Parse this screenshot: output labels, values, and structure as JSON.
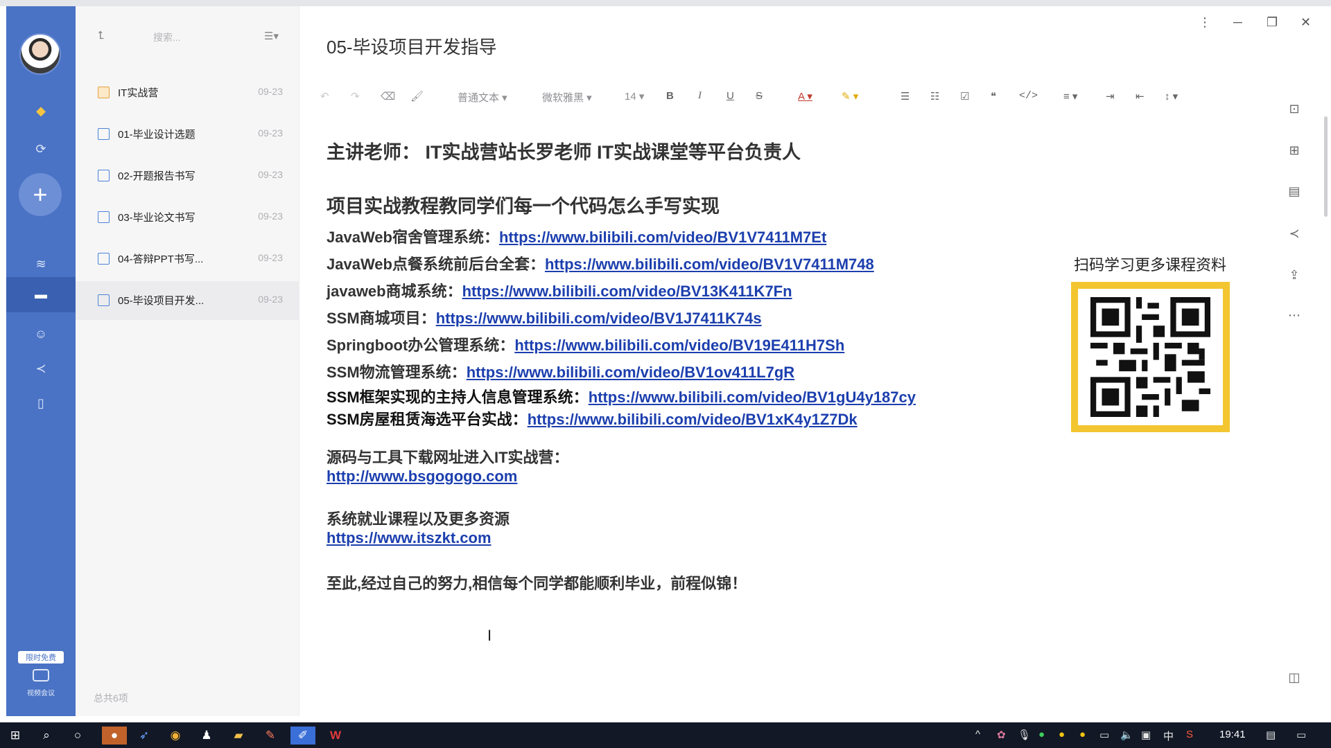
{
  "rail": {
    "icons": [
      "vip-icon",
      "sync-icon",
      "layers-icon",
      "folder-icon",
      "contacts-icon",
      "share-icon",
      "trash-icon"
    ],
    "trial_badge": "限时免费",
    "meeting_label": "视频会议"
  },
  "list": {
    "search_placeholder": "搜索...",
    "items": [
      {
        "title": "IT实战营",
        "date": "09-23",
        "type": "folder"
      },
      {
        "title": "01-毕业设计选题",
        "date": "09-23",
        "type": "note"
      },
      {
        "title": "02-开题报告书写",
        "date": "09-23",
        "type": "note"
      },
      {
        "title": "03-毕业论文书写",
        "date": "09-23",
        "type": "note"
      },
      {
        "title": "04-答辩PPT书写...",
        "date": "09-23",
        "type": "note"
      },
      {
        "title": "05-毕设项目开发...",
        "date": "09-23",
        "type": "note"
      }
    ],
    "footer": "总共6项"
  },
  "editor": {
    "title": "05-毕设项目开发指导",
    "toolbar": {
      "style": "普通文本",
      "font": "微软雅黑",
      "size": "14",
      "bold": "B",
      "italic": "I",
      "underline": "U",
      "strike": "S",
      "color": "A"
    },
    "lecturer": "主讲老师： IT实战营站长罗老师   IT实战课堂等平台负责人",
    "section_title": "项目实战教程教同学们每一个代码怎么手写实现",
    "projects": [
      {
        "label": "JavaWeb宿舍管理系统：",
        "url": "https://www.bilibili.com/video/BV1V7411M7Et"
      },
      {
        "label": "JavaWeb点餐系统前后台全套：",
        "url": "https://www.bilibili.com/video/BV1V7411M748"
      },
      {
        "label": "javaweb商城系统：",
        "url": "https://www.bilibili.com/video/BV13K411K7Fn"
      },
      {
        "label": "SSM商城项目：",
        "url": "https://www.bilibili.com/video/BV1J7411K74s"
      },
      {
        "label": "Springboot办公管理系统：",
        "url": "https://www.bilibili.com/video/BV19E411H7Sh"
      },
      {
        "label": "SSM物流管理系统：",
        "url": "https://www.bilibili.com/video/BV1ov411L7gR"
      },
      {
        "label": "SSM框架实现的主持人信息管理系统：",
        "url": "https://www.bilibili.com/video/BV1gU4y187cy"
      },
      {
        "label": "SSM房屋租赁海选平台实战：",
        "url": "https://www.bilibili.com/video/BV1xK4y1Z7Dk"
      }
    ],
    "source_label": "源码与工具下载网址进入IT实战营：",
    "source_url": "http://www.bsgogogo.com",
    "career_label": "系统就业课程以及更多资源",
    "career_url": "https://www.itszkt.com",
    "closing": "至此,经过自己的努力,相信每个同学都能顺利毕业，前程似锦！",
    "qr_caption": "扫码学习更多课程资料"
  },
  "taskbar": {
    "time": "19:41",
    "ime": "中"
  },
  "colors": {
    "rail": "#4a73c5",
    "link": "#1c3fae",
    "qr_frame": "#f3c530"
  }
}
